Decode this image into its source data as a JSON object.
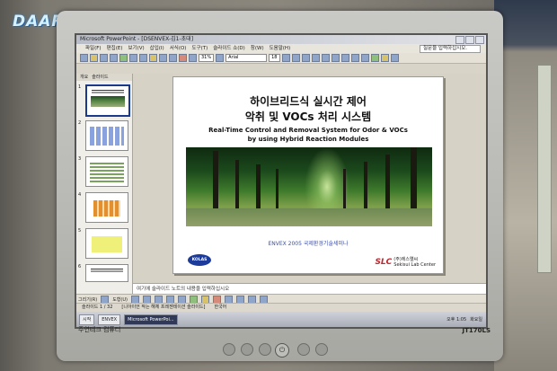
{
  "watermark": "DAARA",
  "window": {
    "title": "Microsoft PowerPoint - [DSENVEX-김1-초대]",
    "menu": [
      "파일(F)",
      "편집(E)",
      "보기(V)",
      "삽입(I)",
      "서식(O)",
      "도구(T)",
      "슬라이드 쇼(D)",
      "창(W)",
      "도움말(H)"
    ],
    "help_placeholder": "질문을 입력하십시오.",
    "zoom": "31%",
    "font": "Arial",
    "font_size": "18"
  },
  "pane_tabs": [
    "개요",
    "슬라이드"
  ],
  "thumbnails": [
    {
      "num": "1",
      "style": "photo",
      "selected": true
    },
    {
      "num": "2",
      "style": "grid",
      "selected": false
    },
    {
      "num": "3",
      "style": "table",
      "selected": false
    },
    {
      "num": "4",
      "style": "orange",
      "selected": false
    },
    {
      "num": "5",
      "style": "yellow",
      "selected": false
    },
    {
      "num": "6",
      "style": "lines",
      "selected": false
    }
  ],
  "slide": {
    "title_ko_1": "하이브리드식 실시간 제어",
    "title_ko_2": "악취 및 VOCs 처리 시스템",
    "title_en_1": "Real-Time Control and Removal System for Odor & VOCs",
    "title_en_2": "by using Hybrid Reaction Modules",
    "seminar": "ENVEX 2005 국제환경기술세미나",
    "logo_left": "KOLAS",
    "logo_right_mark": "SLC",
    "logo_right_text_1": "(주)에스엘씨",
    "logo_right_text_2": "Sekisui Lab Center"
  },
  "notes_placeholder": "여기에 슬라이드 노트의 내용을 입력하십시오",
  "drawbar": {
    "draw_label": "그리기(R)",
    "autoshape_label": "도형(U)"
  },
  "status": {
    "slide_info": "슬라이드 1 / 32",
    "design": "[니아이언 작는 해체 프레젠테이션 슬라이드]",
    "language": "한국어"
  },
  "taskbar": {
    "start": "시작",
    "items": [
      "ENVEX",
      "Microsoft PowerPoi..."
    ],
    "clock": "오후 1:05",
    "day": "화요일"
  },
  "bezel": {
    "brand_left": "주연테크 컴퓨터",
    "model": "JT170LS"
  }
}
